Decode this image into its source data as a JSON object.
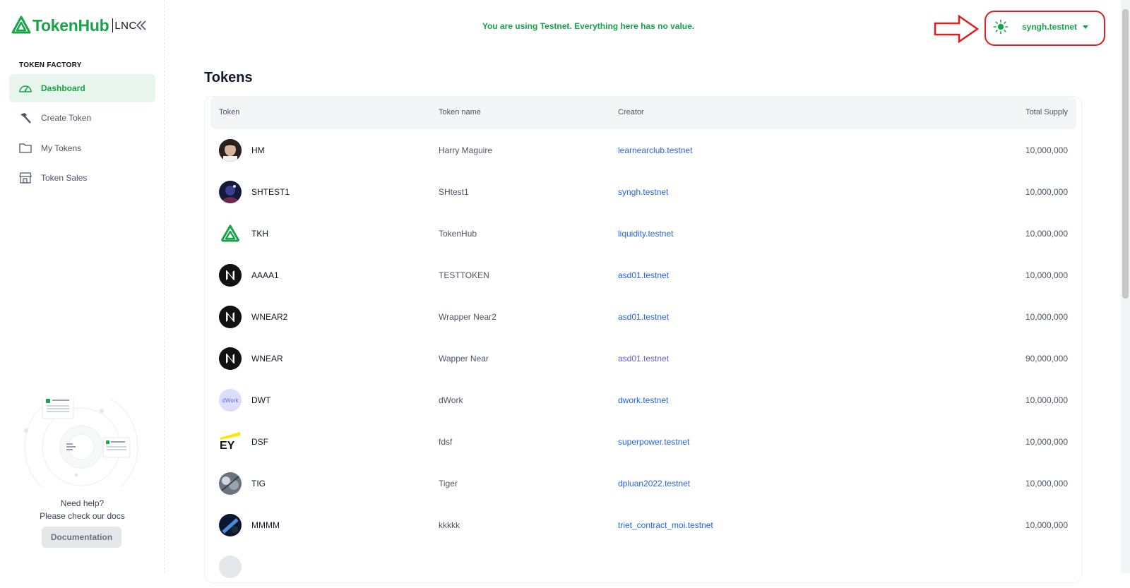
{
  "brand": {
    "name": "TokenHub",
    "suffix": "LNC"
  },
  "sidebar": {
    "section_title": "TOKEN FACTORY",
    "items": [
      {
        "label": "Dashboard",
        "icon": "dashboard-gauge-icon",
        "active": true
      },
      {
        "label": "Create Token",
        "icon": "hammer-icon",
        "active": false
      },
      {
        "label": "My Tokens",
        "icon": "folder-icon",
        "active": false
      },
      {
        "label": "Token Sales",
        "icon": "store-icon",
        "active": false
      }
    ],
    "help": {
      "title": "Need help?",
      "subtitle": "Please check our docs",
      "button": "Documentation"
    }
  },
  "topbar": {
    "notice": "You are using Testnet. Everything here has no value.",
    "account": "syngh.testnet",
    "theme_icon": "sun-icon"
  },
  "page": {
    "title": "Tokens"
  },
  "table": {
    "headers": [
      "Token",
      "Token name",
      "Creator",
      "Total Supply"
    ],
    "rows": [
      {
        "symbol": "HM",
        "name": "Harry Maguire",
        "creator": "learnearclub.testnet",
        "supply": "10,000,000",
        "avatar": "photo"
      },
      {
        "symbol": "SHTEST1",
        "name": "SHtest1",
        "creator": "syngh.testnet",
        "supply": "10,000,000",
        "avatar": "photo-dark"
      },
      {
        "symbol": "TKH",
        "name": "TokenHub",
        "creator": "liquidity.testnet",
        "supply": "10,000,000",
        "avatar": "tokenhub"
      },
      {
        "symbol": "AAAA1",
        "name": "TESTTOKEN",
        "creator": "asd01.testnet",
        "supply": "10,000,000",
        "avatar": "near"
      },
      {
        "symbol": "WNEAR2",
        "name": "Wrapper Near2",
        "creator": "asd01.testnet",
        "supply": "10,000,000",
        "avatar": "near"
      },
      {
        "symbol": "WNEAR",
        "name": "Wapper Near",
        "creator": "asd01.testnet",
        "supply": "90,000,000",
        "avatar": "near"
      },
      {
        "symbol": "DWT",
        "name": "dWork",
        "creator": "dwork.testnet",
        "supply": "10,000,000",
        "avatar": "dwork",
        "avatar_text": "dWork"
      },
      {
        "symbol": "DSF",
        "name": "fdsf",
        "creator": "superpower.testnet",
        "supply": "10,000,000",
        "avatar": "ey",
        "avatar_text": "EY"
      },
      {
        "symbol": "TIG",
        "name": "Tiger",
        "creator": "dpluan2022.testnet",
        "supply": "10,000,000",
        "avatar": "photo-gray"
      },
      {
        "symbol": "MMMM",
        "name": "kkkkk",
        "creator": "triet_contract_moi.testnet",
        "supply": "10,000,000",
        "avatar": "photo-blue"
      }
    ]
  },
  "colors": {
    "accent": "#16a34a",
    "link": "#2563eb",
    "annotation": "#e11d1d"
  }
}
